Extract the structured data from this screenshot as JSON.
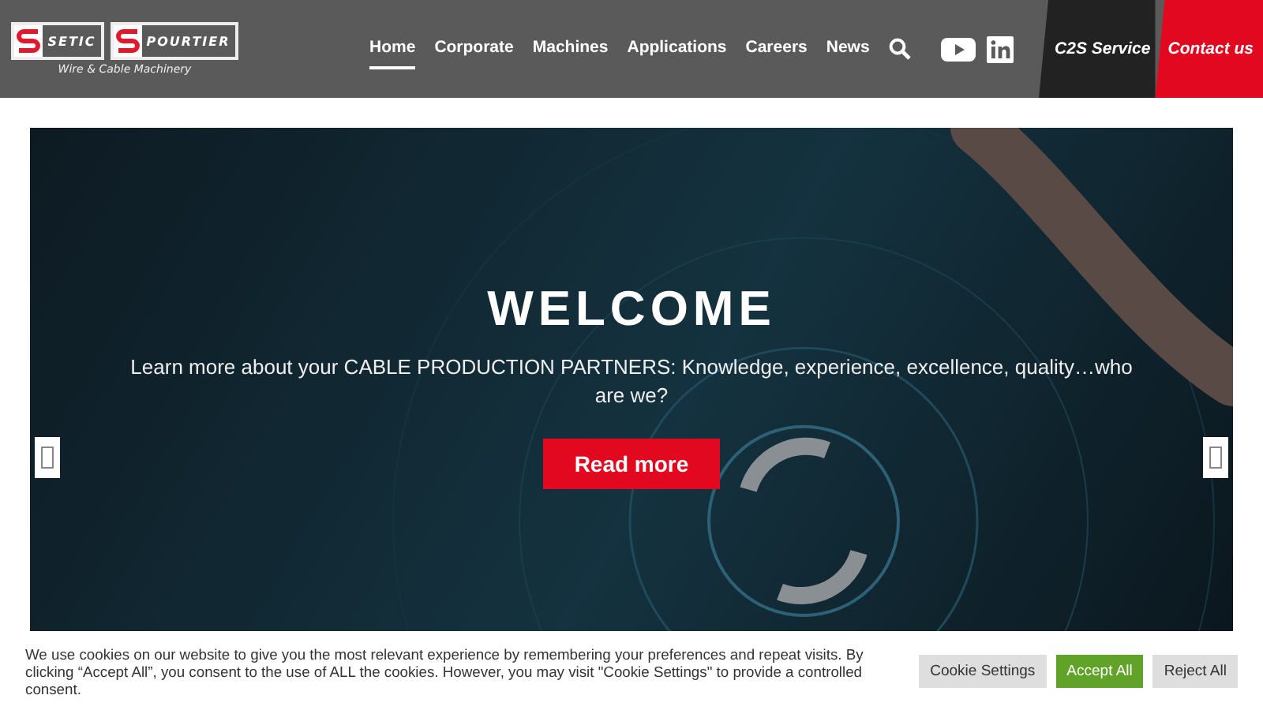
{
  "logo": {
    "brand_1": "SETIC",
    "brand_2": "POURTIER",
    "tagline": "Wire & Cable Machinery"
  },
  "nav": [
    {
      "label": "Home",
      "selected": true
    },
    {
      "label": "Corporate",
      "selected": false
    },
    {
      "label": "Machines",
      "selected": false
    },
    {
      "label": "Applications",
      "selected": false
    },
    {
      "label": "Careers",
      "selected": false
    },
    {
      "label": "News",
      "selected": false
    }
  ],
  "header_links": [
    {
      "label": "C2S Service",
      "kind": "dark"
    },
    {
      "label": "Contact us",
      "kind": "red"
    }
  ],
  "hero": {
    "title": "WELCOME",
    "text": "Learn more about your CABLE PRODUCTION PARTNERS: Knowledge, experience, excellence, quality…who are we?",
    "button": "Read more"
  },
  "cookie": {
    "text": "We use cookies on our website to give you the most relevant experience by remembering your preferences and repeat visits. By clicking “Accept All”, you consent to the use of ALL the cookies. However, you may visit \"Cookie Settings\" to provide a controlled consent.",
    "buttons": [
      {
        "label": "Cookie Settings",
        "kind": "settings"
      },
      {
        "label": "Accept All",
        "kind": "accept"
      },
      {
        "label": "Reject All",
        "kind": "reject"
      }
    ]
  }
}
